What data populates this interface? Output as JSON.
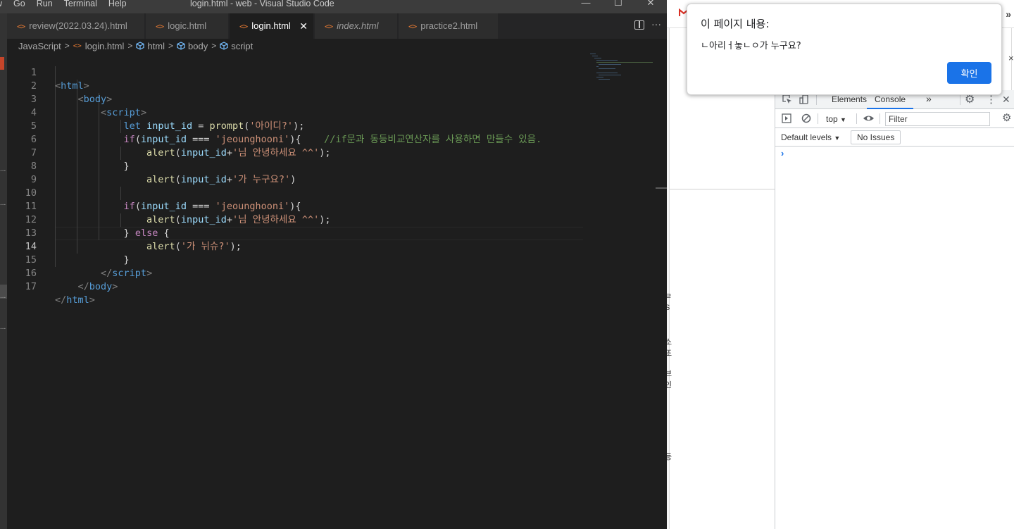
{
  "vscode": {
    "window_title": "login.html - web - Visual Studio Code",
    "menu": [
      "w",
      "Go",
      "Run",
      "Terminal",
      "Help"
    ],
    "window_controls": {
      "minimize": "—",
      "maximize": "☐",
      "close": "✕"
    },
    "tabs": [
      {
        "label": "review(2022.03.24).html",
        "icon": "<>",
        "active": false,
        "italic": false
      },
      {
        "label": "logic.html",
        "icon": "<>",
        "active": false,
        "italic": false
      },
      {
        "label": "login.html",
        "icon": "<>",
        "active": true,
        "italic": false,
        "close": "✕"
      },
      {
        "label": "index.html",
        "icon": "<>",
        "active": false,
        "italic": true
      },
      {
        "label": "practice2.html",
        "icon": "<>",
        "active": false,
        "italic": false
      }
    ],
    "more_actions": "···",
    "breadcrumb": {
      "lang": "JavaScript",
      "file_icon": "<>",
      "file": "login.html",
      "items": [
        "html",
        "body",
        "script"
      ],
      "separator": ">"
    },
    "activity_dots": [
      "...",
      "...",
      "..."
    ],
    "current_line": 14,
    "line_numbers": [
      "1",
      "2",
      "3",
      "4",
      "5",
      "6",
      "7",
      "8",
      "9",
      "10",
      "11",
      "12",
      "13",
      "14",
      "15",
      "16",
      "17"
    ],
    "code": {
      "l1": {
        "open": "<",
        "tag": "html",
        "close": ">"
      },
      "l2": {
        "indent": "    ",
        "open": "<",
        "tag": "body",
        "close": ">"
      },
      "l3": {
        "indent": "        ",
        "open": "<",
        "tag": "script",
        "close": ">"
      },
      "l4": {
        "indent": "            ",
        "kw": "let",
        "var": "input_id",
        "eq": " = ",
        "fn": "prompt",
        "p1": "(",
        "str": "'아이디?'",
        "p2": ");"
      },
      "l5": {
        "indent": "            ",
        "ctl": "if",
        "p1": "(",
        "var": "input_id",
        "op": " === ",
        "str": "'jeounghooni'",
        "p2": "){",
        "gap": "    ",
        "comment": "//if문과 동등비교연산자를 사용하면 만들수 있음."
      },
      "l6": {
        "indent": "                ",
        "fn": "alert",
        "p1": "(",
        "var": "input_id",
        "plus": "+",
        "str": "'님 안녕하세요 ^^'",
        "p2": ");"
      },
      "l7": {
        "indent": "            ",
        "text": "}"
      },
      "l8": {
        "indent": "                ",
        "fn": "alert",
        "p1": "(",
        "var": "input_id",
        "plus": "+",
        "str": "'가 누구요?'",
        "p2": ")"
      },
      "l10": {
        "indent": "            ",
        "ctl": "if",
        "p1": "(",
        "var": "input_id",
        "op": " === ",
        "str": "'jeounghooni'",
        "p2": "){"
      },
      "l11": {
        "indent": "                ",
        "fn": "alert",
        "p1": "(",
        "var": "input_id",
        "plus": "+",
        "str": "'님 안녕하세요 ^^'",
        "p2": ");"
      },
      "l12": {
        "indent": "            ",
        "b1": "} ",
        "ctl": "else",
        "b2": " {"
      },
      "l13": {
        "indent": "                ",
        "fn": "alert",
        "p1": "(",
        "str": "'가 뉘슈?'",
        "p2": ");"
      },
      "l14": {
        "indent": "            ",
        "text": "}"
      },
      "l15": {
        "indent": "        ",
        "open": "</",
        "tag": "script",
        "close": ">"
      },
      "l16": {
        "indent": "    ",
        "open": "</",
        "tag": "body",
        "close": ">"
      },
      "l17": {
        "open": "</",
        "tag": "html",
        "close": ">"
      }
    }
  },
  "chrome": {
    "tabs_more": "»",
    "page_glyphs": [
      "ㄹ",
      "S",
      "소",
      "또",
      "브",
      "인",
      "등"
    ],
    "alert": {
      "title": "이 페이지 내용:",
      "message": "ㄴ아리ㅓ놓ㄴㅇ가 누구요?",
      "ok": "확인"
    },
    "side_close": "×",
    "devtools": {
      "tabs": [
        "Elements",
        "Console"
      ],
      "active_tab": "Console",
      "overflow": "»",
      "menu": "⋮",
      "close": "✕",
      "context": "top",
      "context_arrow": "▼",
      "filter_placeholder": "Filter",
      "levels": "Default levels",
      "levels_arrow": "▼",
      "issues": "No Issues",
      "prompt": "›"
    }
  },
  "colors": {
    "editor_bg": "#1e1e1e",
    "accent": "#1a73e8",
    "tag": "#569cd6",
    "string": "#ce9178",
    "comment": "#6a9955"
  }
}
